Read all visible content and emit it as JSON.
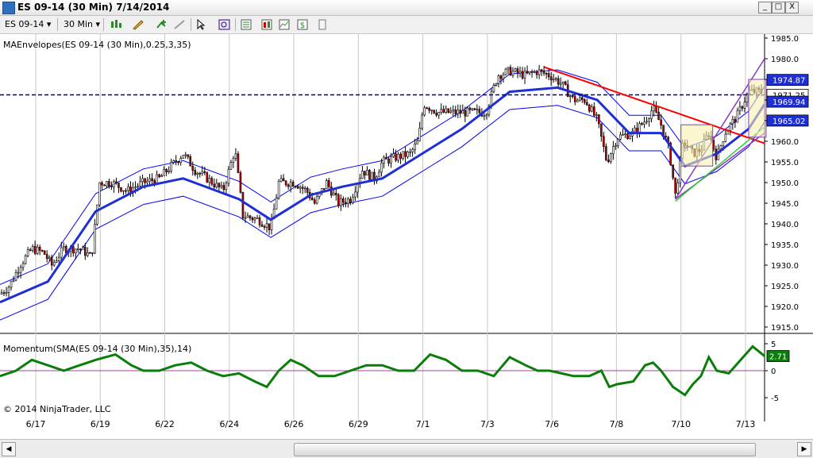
{
  "window": {
    "title": "ES 09-14 (30 Min)  7/14/2014",
    "min_label": "_",
    "max_label": "□",
    "close_label": "X"
  },
  "toolbar": {
    "instrument": "ES 09-14",
    "interval": "30 Min"
  },
  "indicators": {
    "price_label": "MAEnvelopes(ES 09-14 (30 Min),0.25,3,35)",
    "momentum_label": "Momentum(SMA(ES 09-14 (30 Min),35),14)"
  },
  "copyright": "© 2014 NinjaTrader, LLC",
  "colors": {
    "price_up": "#ffffff",
    "price_down": "#c00000",
    "envelope": "#0000ff",
    "ma": "#1e2fd6",
    "momentum": "#0a7d0a",
    "trend_red": "#ff0000",
    "channel_purple": "#8a3ac0",
    "channel_green": "#2ecc2e",
    "box_fill": "#f5f0b0",
    "dashed": "#00007f"
  },
  "chart_data": {
    "type": "candlestick",
    "x_ticks": [
      "6/17",
      "6/19",
      "6/22",
      "6/24",
      "6/26",
      "6/29",
      "7/1",
      "7/3",
      "7/6",
      "7/8",
      "7/10",
      "7/13"
    ],
    "price_axis": {
      "min": 1915,
      "max": 1985,
      "ticks": [
        1985,
        1980,
        1975,
        1970,
        1965,
        1960,
        1955,
        1950,
        1945,
        1940,
        1935,
        1930,
        1925,
        1920,
        1915
      ]
    },
    "momentum_axis": {
      "min": -5,
      "max": 5,
      "ticks": [
        5,
        0,
        -5
      ]
    },
    "price_path": [
      [
        0,
        1923
      ],
      [
        12,
        1925
      ],
      [
        25,
        1930
      ],
      [
        40,
        1934
      ],
      [
        55,
        1933
      ],
      [
        65,
        1930
      ],
      [
        80,
        1934
      ],
      [
        100,
        1934
      ],
      [
        115,
        1932
      ],
      [
        125,
        1950
      ],
      [
        140,
        1950
      ],
      [
        160,
        1948
      ],
      [
        180,
        1950
      ],
      [
        200,
        1951
      ],
      [
        215,
        1954
      ],
      [
        230,
        1957
      ],
      [
        245,
        1953
      ],
      [
        260,
        1951
      ],
      [
        280,
        1948
      ],
      [
        295,
        1958
      ],
      [
        305,
        1942
      ],
      [
        325,
        1941
      ],
      [
        340,
        1939
      ],
      [
        350,
        1950
      ],
      [
        370,
        1950
      ],
      [
        385,
        1948
      ],
      [
        395,
        1945
      ],
      [
        410,
        1950
      ],
      [
        425,
        1945
      ],
      [
        440,
        1946
      ],
      [
        455,
        1953
      ],
      [
        470,
        1951
      ],
      [
        480,
        1955
      ],
      [
        495,
        1956
      ],
      [
        515,
        1957
      ],
      [
        525,
        1960
      ],
      [
        532,
        1969
      ],
      [
        550,
        1967
      ],
      [
        570,
        1967
      ],
      [
        590,
        1967
      ],
      [
        610,
        1967
      ],
      [
        625,
        1976
      ],
      [
        640,
        1977
      ],
      [
        660,
        1976
      ],
      [
        675,
        1977
      ],
      [
        690,
        1976
      ],
      [
        705,
        1974
      ],
      [
        720,
        1970
      ],
      [
        735,
        1970
      ],
      [
        750,
        1965
      ],
      [
        762,
        1955
      ],
      [
        775,
        1961
      ],
      [
        795,
        1962
      ],
      [
        810,
        1965
      ],
      [
        820,
        1968
      ],
      [
        830,
        1964
      ],
      [
        840,
        1958
      ],
      [
        848,
        1947
      ],
      [
        858,
        1960
      ],
      [
        870,
        1957
      ],
      [
        880,
        1958
      ],
      [
        890,
        1962
      ],
      [
        900,
        1956
      ],
      [
        910,
        1962
      ],
      [
        925,
        1966
      ],
      [
        940,
        1972
      ],
      [
        955,
        1972
      ]
    ],
    "ma_path": [
      [
        0,
        1921
      ],
      [
        60,
        1926
      ],
      [
        120,
        1943
      ],
      [
        180,
        1949
      ],
      [
        230,
        1951
      ],
      [
        300,
        1946
      ],
      [
        340,
        1941
      ],
      [
        390,
        1947
      ],
      [
        430,
        1949
      ],
      [
        480,
        1951
      ],
      [
        530,
        1957
      ],
      [
        580,
        1963
      ],
      [
        640,
        1972
      ],
      [
        700,
        1973
      ],
      [
        750,
        1970
      ],
      [
        790,
        1962
      ],
      [
        830,
        1962
      ],
      [
        860,
        1954
      ],
      [
        900,
        1957
      ],
      [
        940,
        1963
      ],
      [
        960,
        1969
      ]
    ],
    "momentum_path": [
      [
        0,
        -1
      ],
      [
        20,
        0
      ],
      [
        40,
        2
      ],
      [
        60,
        1
      ],
      [
        80,
        0
      ],
      [
        100,
        1
      ],
      [
        120,
        2
      ],
      [
        145,
        3
      ],
      [
        165,
        1
      ],
      [
        180,
        0
      ],
      [
        200,
        0
      ],
      [
        220,
        1
      ],
      [
        240,
        1.5
      ],
      [
        260,
        0
      ],
      [
        280,
        -1
      ],
      [
        300,
        -0.5
      ],
      [
        320,
        -2
      ],
      [
        335,
        -3
      ],
      [
        350,
        0
      ],
      [
        365,
        2
      ],
      [
        380,
        1
      ],
      [
        400,
        -1
      ],
      [
        420,
        -1
      ],
      [
        440,
        0
      ],
      [
        460,
        1
      ],
      [
        480,
        1
      ],
      [
        500,
        0
      ],
      [
        520,
        0
      ],
      [
        540,
        3
      ],
      [
        560,
        2
      ],
      [
        580,
        0
      ],
      [
        600,
        0
      ],
      [
        620,
        -1
      ],
      [
        640,
        2.5
      ],
      [
        660,
        1
      ],
      [
        675,
        0
      ],
      [
        690,
        0
      ],
      [
        705,
        -0.5
      ],
      [
        720,
        -1
      ],
      [
        740,
        -1
      ],
      [
        755,
        0
      ],
      [
        765,
        -3
      ],
      [
        775,
        -2.5
      ],
      [
        795,
        -2
      ],
      [
        810,
        1
      ],
      [
        820,
        1.5
      ],
      [
        830,
        0
      ],
      [
        845,
        -3
      ],
      [
        860,
        -4.5
      ],
      [
        870,
        -2.5
      ],
      [
        880,
        -1
      ],
      [
        890,
        2.5
      ],
      [
        900,
        0
      ],
      [
        915,
        -0.5
      ],
      [
        930,
        2
      ],
      [
        945,
        4.5
      ],
      [
        960,
        2.7
      ]
    ],
    "value_labels": {
      "ma_upper": "1974.87",
      "last_price": "1971.25",
      "middle": "1969.94",
      "ma_lower": "1965.02",
      "momentum_value": "2.71"
    },
    "horizontal_line": 1971.25
  }
}
